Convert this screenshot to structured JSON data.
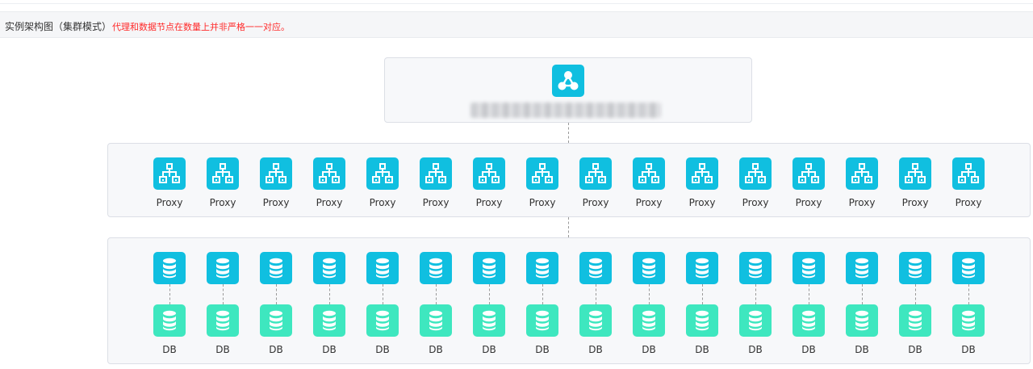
{
  "header": {
    "title": "实例架构图（集群模式）",
    "note": "代理和数据节点在数量上并非严格一一对应。"
  },
  "colors": {
    "primary": "#10bfe0",
    "db_green": "#3ee7bf",
    "note_red": "#ff2a2a",
    "panel_bg": "#f7f8fa",
    "panel_border": "#dcdfe6"
  },
  "root": {
    "icon": "cluster-icon"
  },
  "proxies": [
    {
      "label": "Proxy",
      "icon": "proxy-icon"
    },
    {
      "label": "Proxy",
      "icon": "proxy-icon"
    },
    {
      "label": "Proxy",
      "icon": "proxy-icon"
    },
    {
      "label": "Proxy",
      "icon": "proxy-icon"
    },
    {
      "label": "Proxy",
      "icon": "proxy-icon"
    },
    {
      "label": "Proxy",
      "icon": "proxy-icon"
    },
    {
      "label": "Proxy",
      "icon": "proxy-icon"
    },
    {
      "label": "Proxy",
      "icon": "proxy-icon"
    },
    {
      "label": "Proxy",
      "icon": "proxy-icon"
    },
    {
      "label": "Proxy",
      "icon": "proxy-icon"
    },
    {
      "label": "Proxy",
      "icon": "proxy-icon"
    },
    {
      "label": "Proxy",
      "icon": "proxy-icon"
    },
    {
      "label": "Proxy",
      "icon": "proxy-icon"
    },
    {
      "label": "Proxy",
      "icon": "proxy-icon"
    },
    {
      "label": "Proxy",
      "icon": "proxy-icon"
    },
    {
      "label": "Proxy",
      "icon": "proxy-icon"
    }
  ],
  "db_pairs": [
    {
      "label": "DB",
      "icon": "database-icon"
    },
    {
      "label": "DB",
      "icon": "database-icon"
    },
    {
      "label": "DB",
      "icon": "database-icon"
    },
    {
      "label": "DB",
      "icon": "database-icon"
    },
    {
      "label": "DB",
      "icon": "database-icon"
    },
    {
      "label": "DB",
      "icon": "database-icon"
    },
    {
      "label": "DB",
      "icon": "database-icon"
    },
    {
      "label": "DB",
      "icon": "database-icon"
    },
    {
      "label": "DB",
      "icon": "database-icon"
    },
    {
      "label": "DB",
      "icon": "database-icon"
    },
    {
      "label": "DB",
      "icon": "database-icon"
    },
    {
      "label": "DB",
      "icon": "database-icon"
    },
    {
      "label": "DB",
      "icon": "database-icon"
    },
    {
      "label": "DB",
      "icon": "database-icon"
    },
    {
      "label": "DB",
      "icon": "database-icon"
    },
    {
      "label": "DB",
      "icon": "database-icon"
    }
  ]
}
